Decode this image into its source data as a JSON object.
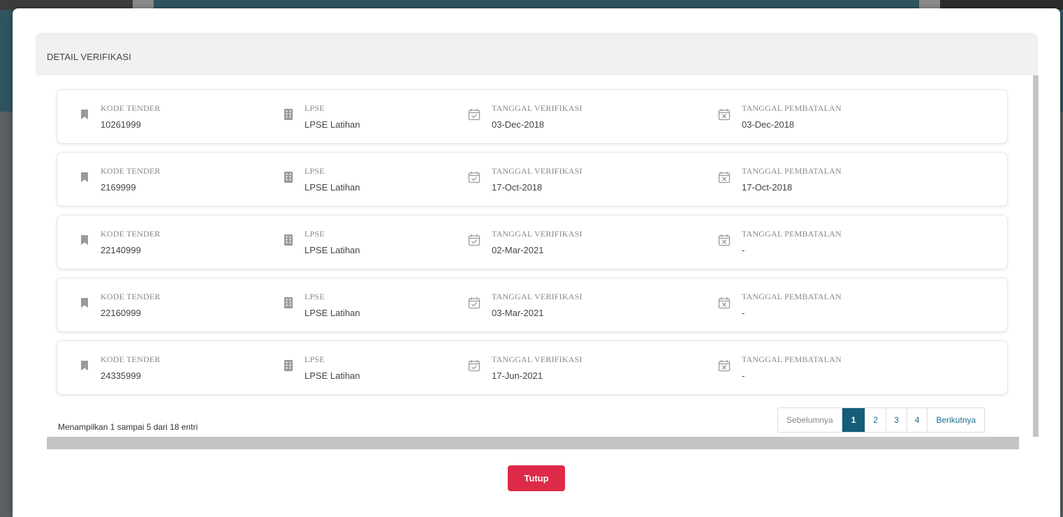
{
  "modal": {
    "title": "DETAIL VERIFIKASI",
    "close_label": "Tutup"
  },
  "labels": {
    "kode_tender": "KODE TENDER",
    "lpse": "LPSE",
    "tanggal_verifikasi": "TANGGAL VERIFIKASI",
    "tanggal_pembatalan": "TANGGAL PEMBATALAN"
  },
  "icons": {
    "kode_tender": "bookmark-icon",
    "lpse": "building-icon",
    "tanggal_verifikasi": "calendar-check-icon",
    "tanggal_pembatalan": "calendar-x-icon"
  },
  "rows": [
    {
      "kode_tender": "10261999",
      "lpse": "LPSE Latihan",
      "tanggal_verifikasi": "03-Dec-2018",
      "tanggal_pembatalan": "03-Dec-2018"
    },
    {
      "kode_tender": "2169999",
      "lpse": "LPSE Latihan",
      "tanggal_verifikasi": "17-Oct-2018",
      "tanggal_pembatalan": "17-Oct-2018"
    },
    {
      "kode_tender": "22140999",
      "lpse": "LPSE Latihan",
      "tanggal_verifikasi": "02-Mar-2021",
      "tanggal_pembatalan": "-"
    },
    {
      "kode_tender": "22160999",
      "lpse": "LPSE Latihan",
      "tanggal_verifikasi": "03-Mar-2021",
      "tanggal_pembatalan": "-"
    },
    {
      "kode_tender": "24335999",
      "lpse": "LPSE Latihan",
      "tanggal_verifikasi": "17-Jun-2021",
      "tanggal_pembatalan": "-"
    }
  ],
  "pagination": {
    "info": "Menampilkan 1 sampai 5 dari 18 entri",
    "prev_label": "Sebelumnya",
    "next_label": "Berikutnya",
    "pages": [
      "1",
      "2",
      "3",
      "4"
    ],
    "current_page": "1"
  },
  "colors": {
    "accent": "#145d78",
    "close_button": "#dc2a48"
  }
}
